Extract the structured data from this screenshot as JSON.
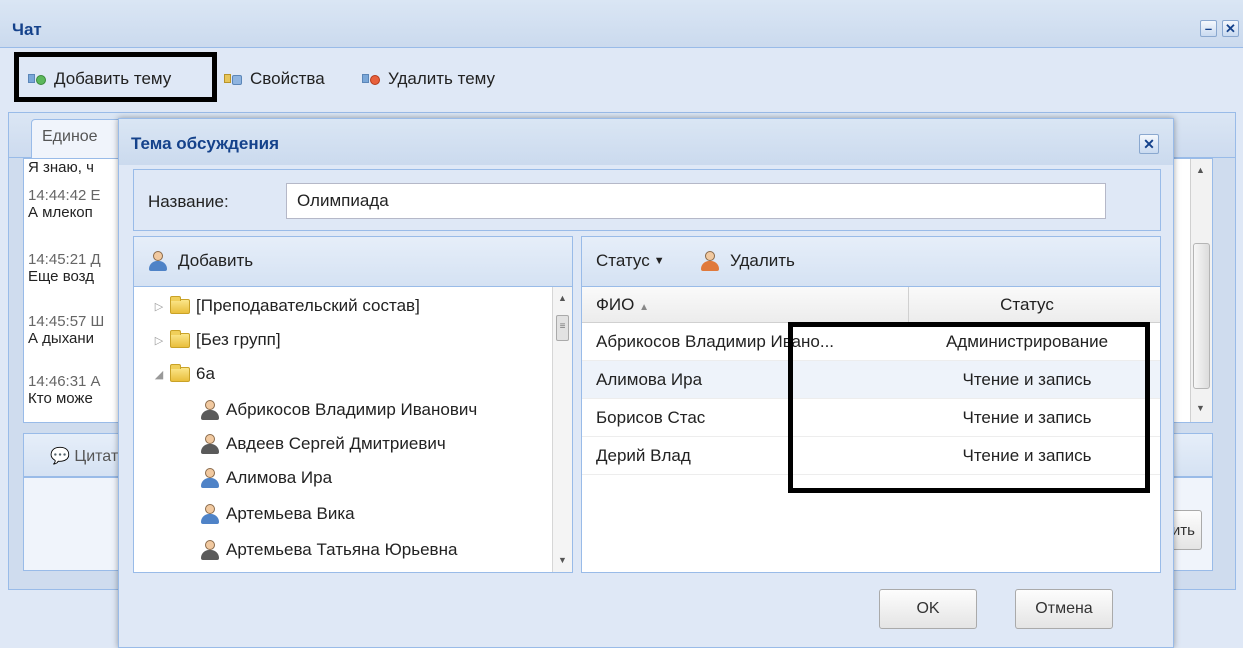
{
  "window": {
    "title": "Чат",
    "minimize_label": "–",
    "close_label": "✕"
  },
  "toolbar": {
    "add_topic": "Добавить тему",
    "properties": "Свойства",
    "delete_topic": "Удалить тему"
  },
  "tabs": [
    {
      "label": "Единое"
    }
  ],
  "messages": [
    {
      "time": "",
      "text": "Я знаю, ч"
    },
    {
      "time": "14:44:42 Е",
      "text": "А млекоп"
    },
    {
      "time": "14:45:21 Д",
      "text": "Еще возд"
    },
    {
      "time": "14:45:57 Ш",
      "text": "А дыхани"
    },
    {
      "time": "14:46:31 А",
      "text": "Кто може"
    }
  ],
  "quote": {
    "label": "Цитат"
  },
  "send_button": "ить",
  "dialog": {
    "title": "Тема обсуждения",
    "close_label": "✕",
    "name_label": "Название:",
    "name_value": "Олимпиада",
    "left": {
      "add_label": "Добавить",
      "tree": [
        {
          "label": "[Преподавательский состав]",
          "type": "folder",
          "expander": "▷"
        },
        {
          "label": "[Без групп]",
          "type": "folder",
          "expander": "▷"
        },
        {
          "label": "6а",
          "type": "folder",
          "expander": "◢"
        },
        {
          "label": "Абрикосов Владимир Иванович",
          "type": "person-dark"
        },
        {
          "label": "Авдеев Сергей Дмитриевич",
          "type": "person-dark"
        },
        {
          "label": "Алимова Ира",
          "type": "person-blue"
        },
        {
          "label": "Артемьева Вика",
          "type": "person-blue"
        },
        {
          "label": "Артемьева Татьяна Юрьевна",
          "type": "person-dark"
        }
      ]
    },
    "right": {
      "status_label": "Статус",
      "delete_label": "Удалить",
      "col_fio": "ФИО",
      "col_status": "Статус",
      "rows": [
        {
          "fio": "Абрикосов Владимир Ивано...",
          "status": "Администрирование"
        },
        {
          "fio": "Алимова Ира",
          "status": "Чтение и запись"
        },
        {
          "fio": "Борисов Стас",
          "status": "Чтение и запись"
        },
        {
          "fio": "Дерий Влад",
          "status": "Чтение и запись"
        }
      ]
    },
    "ok_label": "OK",
    "cancel_label": "Отмена"
  },
  "colors": {
    "header_text": "#15428b",
    "panel_border": "#99bbe8",
    "panel_bg": "#dfe8f6",
    "highlight": "#000000"
  }
}
